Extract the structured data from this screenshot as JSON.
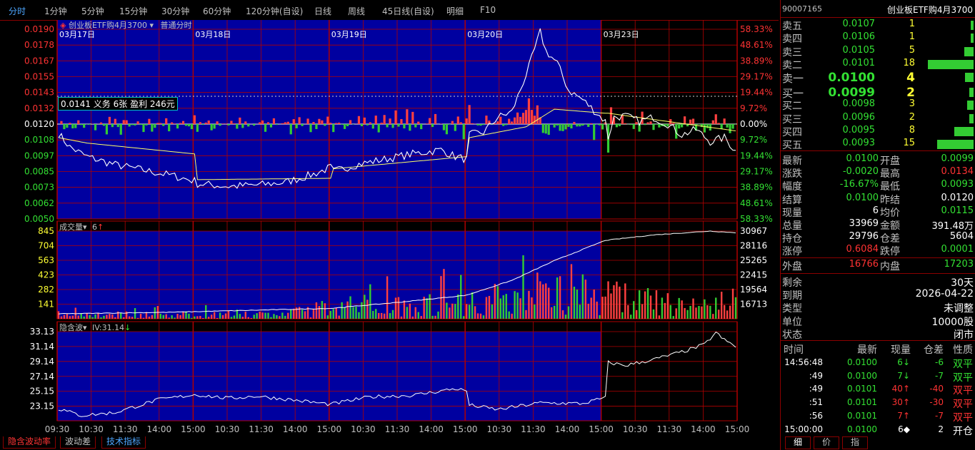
{
  "period_tabs": [
    "分时",
    "1分钟",
    "5分钟",
    "15分钟",
    "30分钟",
    "60分钟",
    "120分钟(自设)",
    "日线",
    "周线",
    "45日线(自设)",
    "明细",
    "F10"
  ],
  "active_tab": "分时",
  "chart_header": {
    "contract_name": "创业板ETF购4月3700",
    "mode": "普通分时",
    "tooltip": "0.0141 义务 6张 盈利 246元"
  },
  "volume_panel": {
    "title": "成交量",
    "value": "6",
    "arrow": "↑"
  },
  "iv_panel": {
    "title": "隐含波",
    "value": "IV:31.14",
    "arrow": "↓"
  },
  "bottom_tabs": [
    "隐含波动率",
    "波动差",
    "技术指标"
  ],
  "right_panel": {
    "code": "90007165",
    "name": "创业板ETF购4月3700",
    "asks": [
      {
        "label": "卖五",
        "price": "0.0107",
        "qty": "1",
        "bar": 0.06
      },
      {
        "label": "卖四",
        "price": "0.0106",
        "qty": "1",
        "bar": 0.06
      },
      {
        "label": "卖三",
        "price": "0.0105",
        "qty": "5",
        "bar": 0.2
      },
      {
        "label": "卖二",
        "price": "0.0101",
        "qty": "18",
        "bar": 1.0
      },
      {
        "label": "卖一",
        "price": "0.0100",
        "qty": "4",
        "bar": 0.18
      }
    ],
    "bids": [
      {
        "label": "买一",
        "price": "0.0099",
        "qty": "2",
        "bar": 0.1
      },
      {
        "label": "买二",
        "price": "0.0098",
        "qty": "3",
        "bar": 0.14
      },
      {
        "label": "买三",
        "price": "0.0096",
        "qty": "2",
        "bar": 0.1
      },
      {
        "label": "买四",
        "price": "0.0095",
        "qty": "8",
        "bar": 0.42
      },
      {
        "label": "买五",
        "price": "0.0093",
        "qty": "15",
        "bar": 0.8
      }
    ],
    "stats": [
      {
        "l1": "最新",
        "v1": "0.0100",
        "c1": "green",
        "l2": "开盘",
        "v2": "0.0099",
        "c2": "green"
      },
      {
        "l1": "涨跌",
        "v1": "-0.0020",
        "c1": "green",
        "l2": "最高",
        "v2": "0.0134",
        "c2": "red"
      },
      {
        "l1": "幅度",
        "v1": "-16.67%",
        "c1": "green",
        "l2": "最低",
        "v2": "0.0093",
        "c2": "green"
      },
      {
        "l1": "结算",
        "v1": "0.0100",
        "c1": "green",
        "l2": "昨结",
        "v2": "0.0120",
        "c2": "white"
      },
      {
        "l1": "现量",
        "v1": "6",
        "c1": "white",
        "l2": "均价",
        "v2": "0.0115",
        "c2": "green"
      },
      {
        "l1": "总量",
        "v1": "33969",
        "c1": "white",
        "l2": "金额",
        "v2": "391.48万",
        "c2": "white"
      },
      {
        "l1": "持仓",
        "v1": "29796",
        "c1": "white",
        "l2": "仓差",
        "v2": "5604",
        "c2": "white"
      },
      {
        "l1": "涨停",
        "v1": "0.6084",
        "c1": "red",
        "l2": "跌停",
        "v2": "0.0001",
        "c2": "green"
      }
    ],
    "outer_inner": {
      "l1": "外盘",
      "v1": "16766",
      "l2": "内盘",
      "v2": "17203"
    },
    "info": [
      {
        "label": "剩余",
        "value": "30天"
      },
      {
        "label": "到期",
        "value": "2026-04-22"
      },
      {
        "label": "类型",
        "value": "未调整"
      },
      {
        "label": "单位",
        "value": "10000股"
      },
      {
        "label": "状态",
        "value": "闭市"
      }
    ],
    "ticks_header": [
      "时间",
      "最新",
      "现量",
      "仓差",
      "性质"
    ],
    "ticks": [
      {
        "time": "14:56:48",
        "price": "0.0100",
        "qty": "6",
        "dir": "↓",
        "diff": "-6",
        "kind": "双平",
        "c": "green"
      },
      {
        "time": ":49",
        "price": "0.0100",
        "qty": "7",
        "dir": "↓",
        "diff": "-7",
        "kind": "双平",
        "c": "green"
      },
      {
        "time": ":49",
        "price": "0.0101",
        "qty": "40",
        "dir": "↑",
        "diff": "-40",
        "kind": "双平",
        "c": "red"
      },
      {
        "time": ":51",
        "price": "0.0101",
        "qty": "30",
        "dir": "↑",
        "diff": "-30",
        "kind": "双平",
        "c": "red"
      },
      {
        "time": ":56",
        "price": "0.0101",
        "qty": "7",
        "dir": "↑",
        "diff": "-7",
        "kind": "双平",
        "c": "red"
      },
      {
        "time": "15:00:00",
        "price": "0.0100",
        "qty": "6",
        "dir": "◆",
        "diff": "2",
        "kind": "开仓",
        "c": "white"
      }
    ],
    "bottom_tabs": [
      "细",
      "价",
      "指"
    ]
  },
  "chart_data": [
    {
      "type": "line",
      "title": "创业板ETF购4月3700 普通分时",
      "days": [
        "03月17日",
        "03月18日",
        "03月19日",
        "03月20日",
        "03月23日"
      ],
      "x_ticks": [
        "09:30",
        "10:30",
        "11:30",
        "14:00",
        "15:00",
        "10:30",
        "11:30",
        "14:00",
        "15:00",
        "10:30",
        "11:30",
        "14:00",
        "15:00",
        "10:30",
        "11:30",
        "14:00",
        "15:00",
        "10:30",
        "11:30",
        "14:00",
        "15:00"
      ],
      "y_left_ticks": [
        "0.0190",
        "0.0178",
        "0.0167",
        "0.0155",
        "0.0143",
        "0.0132",
        "0.0120",
        "0.0108",
        "0.0097",
        "0.0085",
        "0.0073",
        "0.0062",
        "0.0050"
      ],
      "y_right_ticks": [
        "58.33%",
        "48.61%",
        "38.89%",
        "29.17%",
        "19.44%",
        "9.72%",
        "0.00%",
        "9.72%",
        "19.44%",
        "29.17%",
        "38.89%",
        "48.61%",
        "58.33%"
      ],
      "ylim": [
        0.005,
        0.019
      ],
      "prev_settle": 0.012,
      "price_keypoints": [
        [
          0,
          0.0113
        ],
        [
          4,
          0.0103
        ],
        [
          10,
          0.0096
        ],
        [
          20,
          0.009
        ],
        [
          30,
          0.0086
        ],
        [
          40,
          0.0082
        ],
        [
          48,
          0.0078
        ],
        [
          49,
          0.0076
        ],
        [
          60,
          0.0074
        ],
        [
          70,
          0.0075
        ],
        [
          80,
          0.0077
        ],
        [
          90,
          0.0083
        ],
        [
          96,
          0.0088
        ],
        [
          97,
          0.0085
        ],
        [
          105,
          0.009
        ],
        [
          115,
          0.0094
        ],
        [
          125,
          0.0098
        ],
        [
          135,
          0.0101
        ],
        [
          140,
          0.0096
        ],
        [
          144,
          0.0094
        ],
        [
          145,
          0.0112
        ],
        [
          150,
          0.0114
        ],
        [
          155,
          0.0125
        ],
        [
          160,
          0.0129
        ],
        [
          166,
          0.0162
        ],
        [
          170,
          0.0188
        ],
        [
          172,
          0.0174
        ],
        [
          176,
          0.0165
        ],
        [
          180,
          0.0145
        ],
        [
          185,
          0.0138
        ],
        [
          190,
          0.0128
        ],
        [
          193,
          0.0122
        ],
        [
          194,
          0.011
        ],
        [
          196,
          0.0125
        ],
        [
          200,
          0.0126
        ],
        [
          205,
          0.0122
        ],
        [
          210,
          0.0125
        ],
        [
          215,
          0.012
        ],
        [
          220,
          0.0112
        ],
        [
          225,
          0.0116
        ],
        [
          230,
          0.0107
        ],
        [
          235,
          0.011
        ],
        [
          239,
          0.01
        ]
      ],
      "avg_keypoints": [
        [
          0,
          0.011
        ],
        [
          10,
          0.0106
        ],
        [
          48,
          0.0098
        ],
        [
          49,
          0.0079
        ],
        [
          96,
          0.008
        ],
        [
          97,
          0.0087
        ],
        [
          144,
          0.0096
        ],
        [
          145,
          0.011
        ],
        [
          165,
          0.0118
        ],
        [
          175,
          0.0131
        ],
        [
          193,
          0.0128
        ],
        [
          194,
          0.0128
        ],
        [
          239,
          0.0115
        ]
      ]
    },
    {
      "type": "bar",
      "title": "成交量",
      "y_left_ticks": [
        "845",
        "704",
        "563",
        "423",
        "282",
        "141"
      ],
      "y_right_ticks": [
        "30967",
        "28116",
        "25265",
        "22415",
        "19564",
        "16713"
      ],
      "ylim": [
        0,
        845
      ],
      "open_interest_range": [
        15000,
        31000
      ],
      "volume_keypoints": [
        [
          0,
          70
        ],
        [
          40,
          60
        ],
        [
          80,
          70
        ],
        [
          100,
          200
        ],
        [
          140,
          220
        ],
        [
          160,
          320
        ],
        [
          180,
          400
        ],
        [
          200,
          300
        ],
        [
          220,
          180
        ],
        [
          239,
          250
        ]
      ],
      "oi_keypoints": [
        [
          0,
          15900
        ],
        [
          40,
          16200
        ],
        [
          80,
          16700
        ],
        [
          96,
          16900
        ],
        [
          120,
          18000
        ],
        [
          144,
          19300
        ],
        [
          160,
          22000
        ],
        [
          175,
          25600
        ],
        [
          193,
          29300
        ],
        [
          210,
          30300
        ],
        [
          230,
          31000
        ],
        [
          239,
          30700
        ]
      ]
    },
    {
      "type": "line",
      "title": "隐含波",
      "y_left_ticks": [
        "33.13",
        "31.14",
        "29.14",
        "27.14",
        "25.15",
        "23.15"
      ],
      "ylim": [
        21.2,
        33.13
      ],
      "iv_keypoints": [
        [
          0,
          22.8
        ],
        [
          8,
          21.9
        ],
        [
          20,
          22.3
        ],
        [
          35,
          24.0
        ],
        [
          48,
          24.7
        ],
        [
          60,
          24.2
        ],
        [
          70,
          24.5
        ],
        [
          80,
          24.1
        ],
        [
          96,
          23.4
        ],
        [
          110,
          24.4
        ],
        [
          125,
          24.6
        ],
        [
          140,
          25.5
        ],
        [
          144,
          25.2
        ],
        [
          145,
          23.3
        ],
        [
          155,
          22.7
        ],
        [
          170,
          23.6
        ],
        [
          185,
          23.5
        ],
        [
          193,
          24.3
        ],
        [
          194,
          29.0
        ],
        [
          200,
          28.6
        ],
        [
          210,
          29.4
        ],
        [
          220,
          30.4
        ],
        [
          228,
          31.4
        ],
        [
          232,
          33.0
        ],
        [
          235,
          32.0
        ],
        [
          239,
          31.14
        ]
      ]
    }
  ]
}
